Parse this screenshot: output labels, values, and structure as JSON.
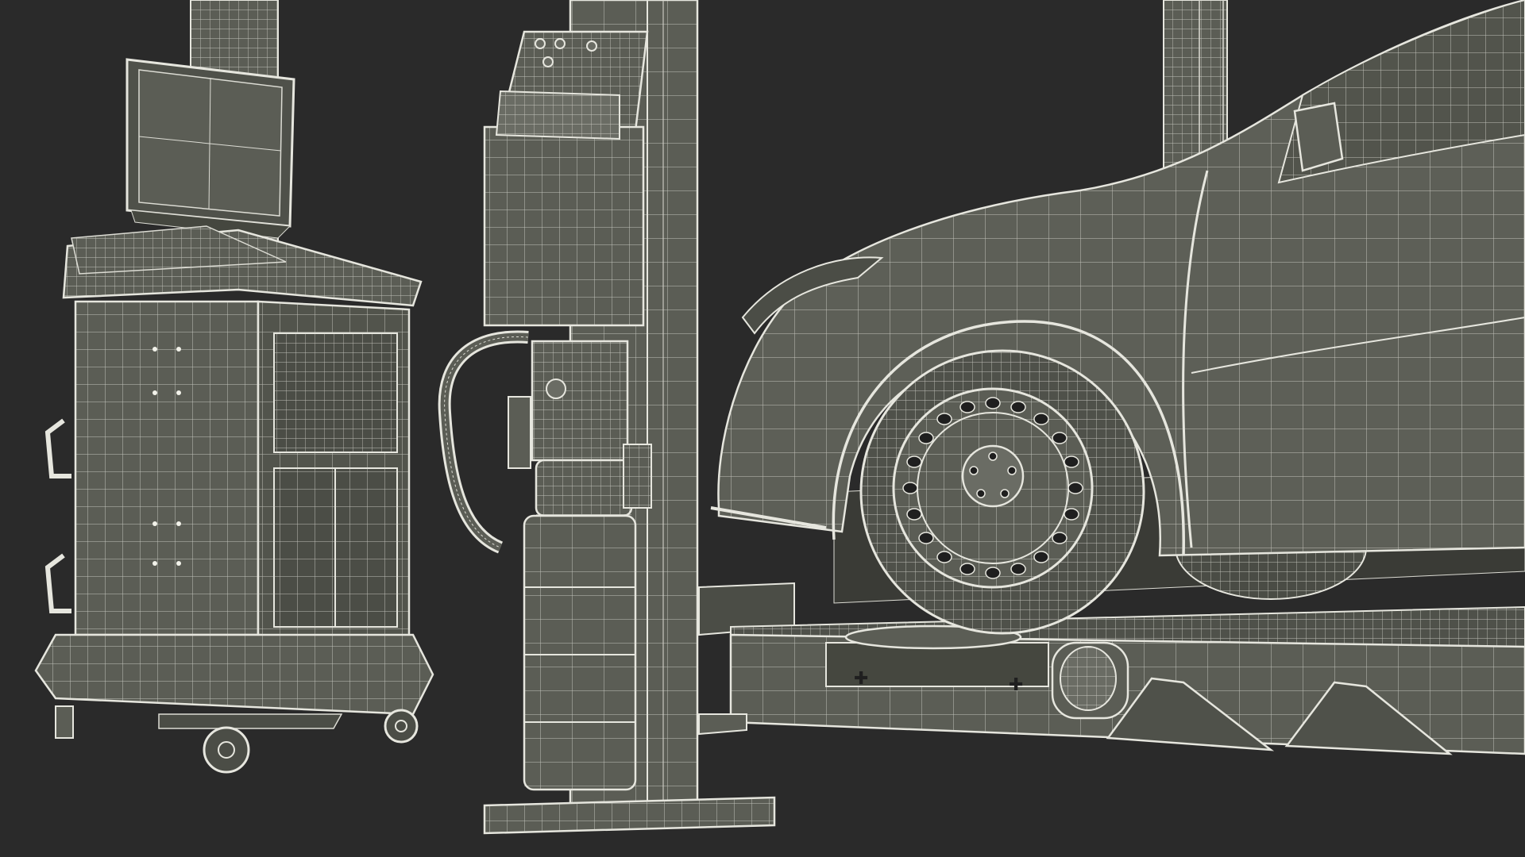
{
  "scene": {
    "background": "#2a2a2a",
    "wire_color": "#dcdcd4",
    "surface_color": "#5b5d55",
    "surface_dark": "#45473f",
    "objects": [
      "alignment-console",
      "two-post-lift",
      "hydraulic-power-unit",
      "vehicle-front",
      "front-wheel",
      "alignment-runway"
    ]
  }
}
